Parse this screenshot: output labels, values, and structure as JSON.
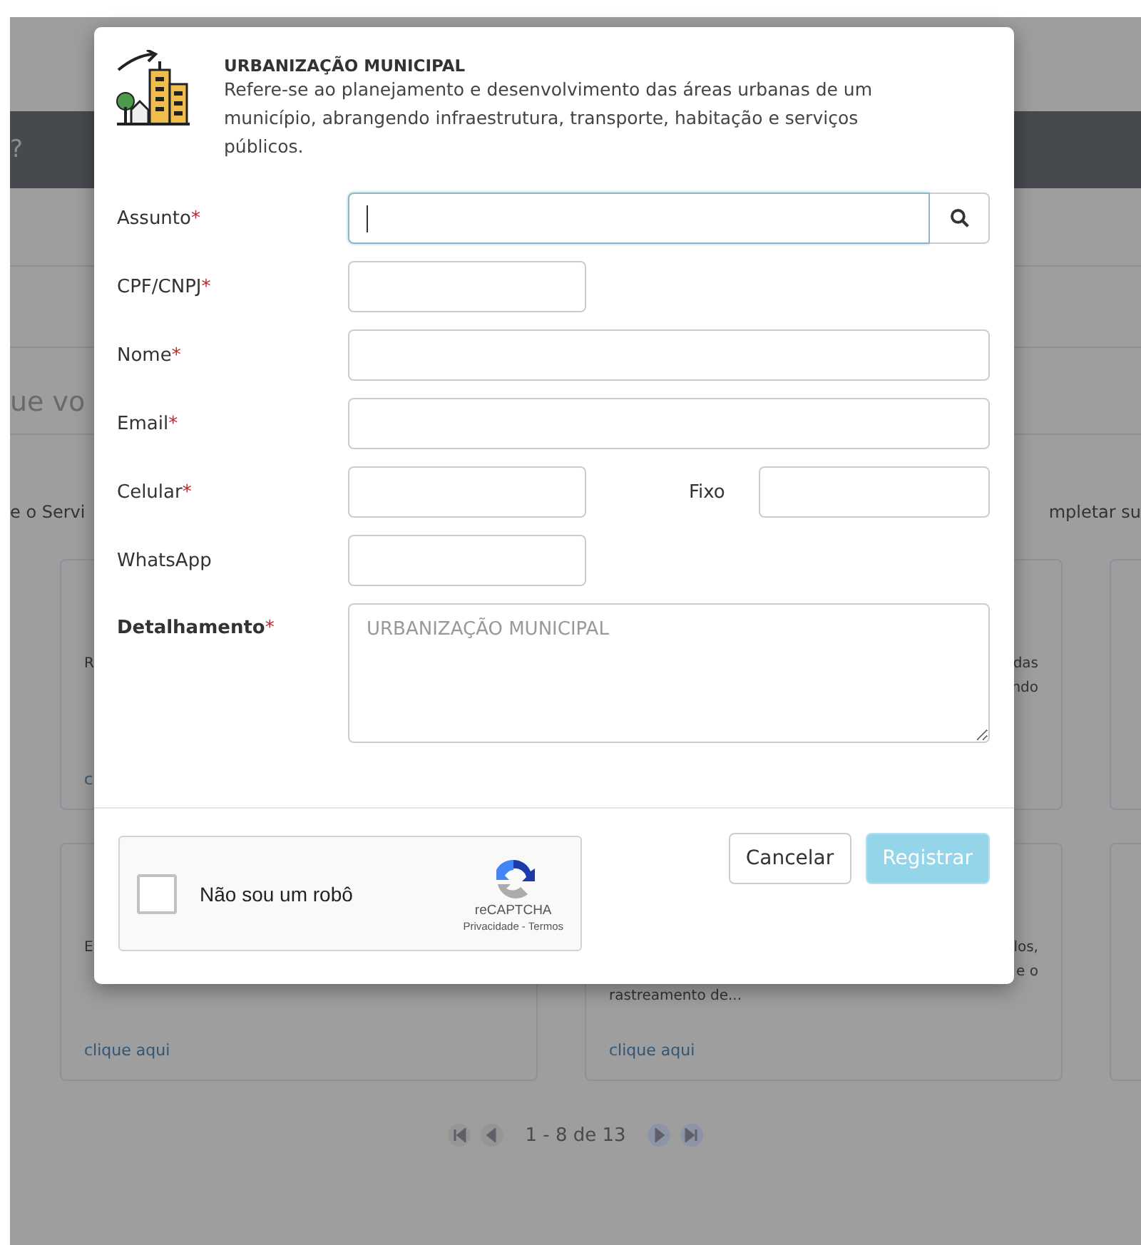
{
  "background": {
    "header_hint": "?",
    "section_title": "ue vo",
    "intro_left": "e o Servi",
    "intro_right": "mpletar su",
    "cards": [
      {
        "lines": [
          "R"
        ],
        "link": "c"
      },
      {
        "right_lines": [
          "das",
          "ndo"
        ]
      },
      {
        "lines": [
          "E"
        ],
        "link": "clique aqui"
      },
      {
        "right_lines": [
          "los,",
          "e o"
        ],
        "lines": [
          "rastreamento de..."
        ],
        "link": "clique aqui"
      }
    ],
    "pagination": {
      "range": "1 - 8 de 13"
    }
  },
  "modal": {
    "title": "URBANIZAÇÃO MUNICIPAL",
    "description": "Refere-se ao planejamento e desenvolvimento das áreas urbanas de um município, abrangendo infraestrutura, transporte, habitação e serviços públicos.",
    "required_mark": "*",
    "fields": [
      {
        "kind": "search",
        "label": "Assunto",
        "required": true,
        "focused": true
      },
      {
        "kind": "short",
        "label": "CPF/CNPJ",
        "required": true,
        "focused": false
      },
      {
        "kind": "wide",
        "label": "Nome",
        "required": true,
        "focused": false
      },
      {
        "kind": "wide",
        "label": "Email",
        "required": true,
        "focused": false
      },
      {
        "kind": "pair",
        "label": "Celular",
        "required": true,
        "focused": false,
        "second_label": "Fixo"
      },
      {
        "kind": "short",
        "label": "WhatsApp",
        "required": false,
        "focused": false
      },
      {
        "kind": "textarea",
        "label": "Detalhamento",
        "required": true,
        "focused": false,
        "placeholder": "URBANIZAÇÃO MUNICIPAL"
      }
    ],
    "captcha": {
      "label": "Não sou um robô",
      "brand": "reCAPTCHA",
      "privacy": "Privacidade",
      "separator": "-",
      "terms": "Termos",
      "checked": false
    },
    "buttons": [
      {
        "label": "Cancelar",
        "kind": "secondary",
        "disabled": false
      },
      {
        "label": "Registrar",
        "kind": "primary",
        "disabled": true
      }
    ]
  }
}
